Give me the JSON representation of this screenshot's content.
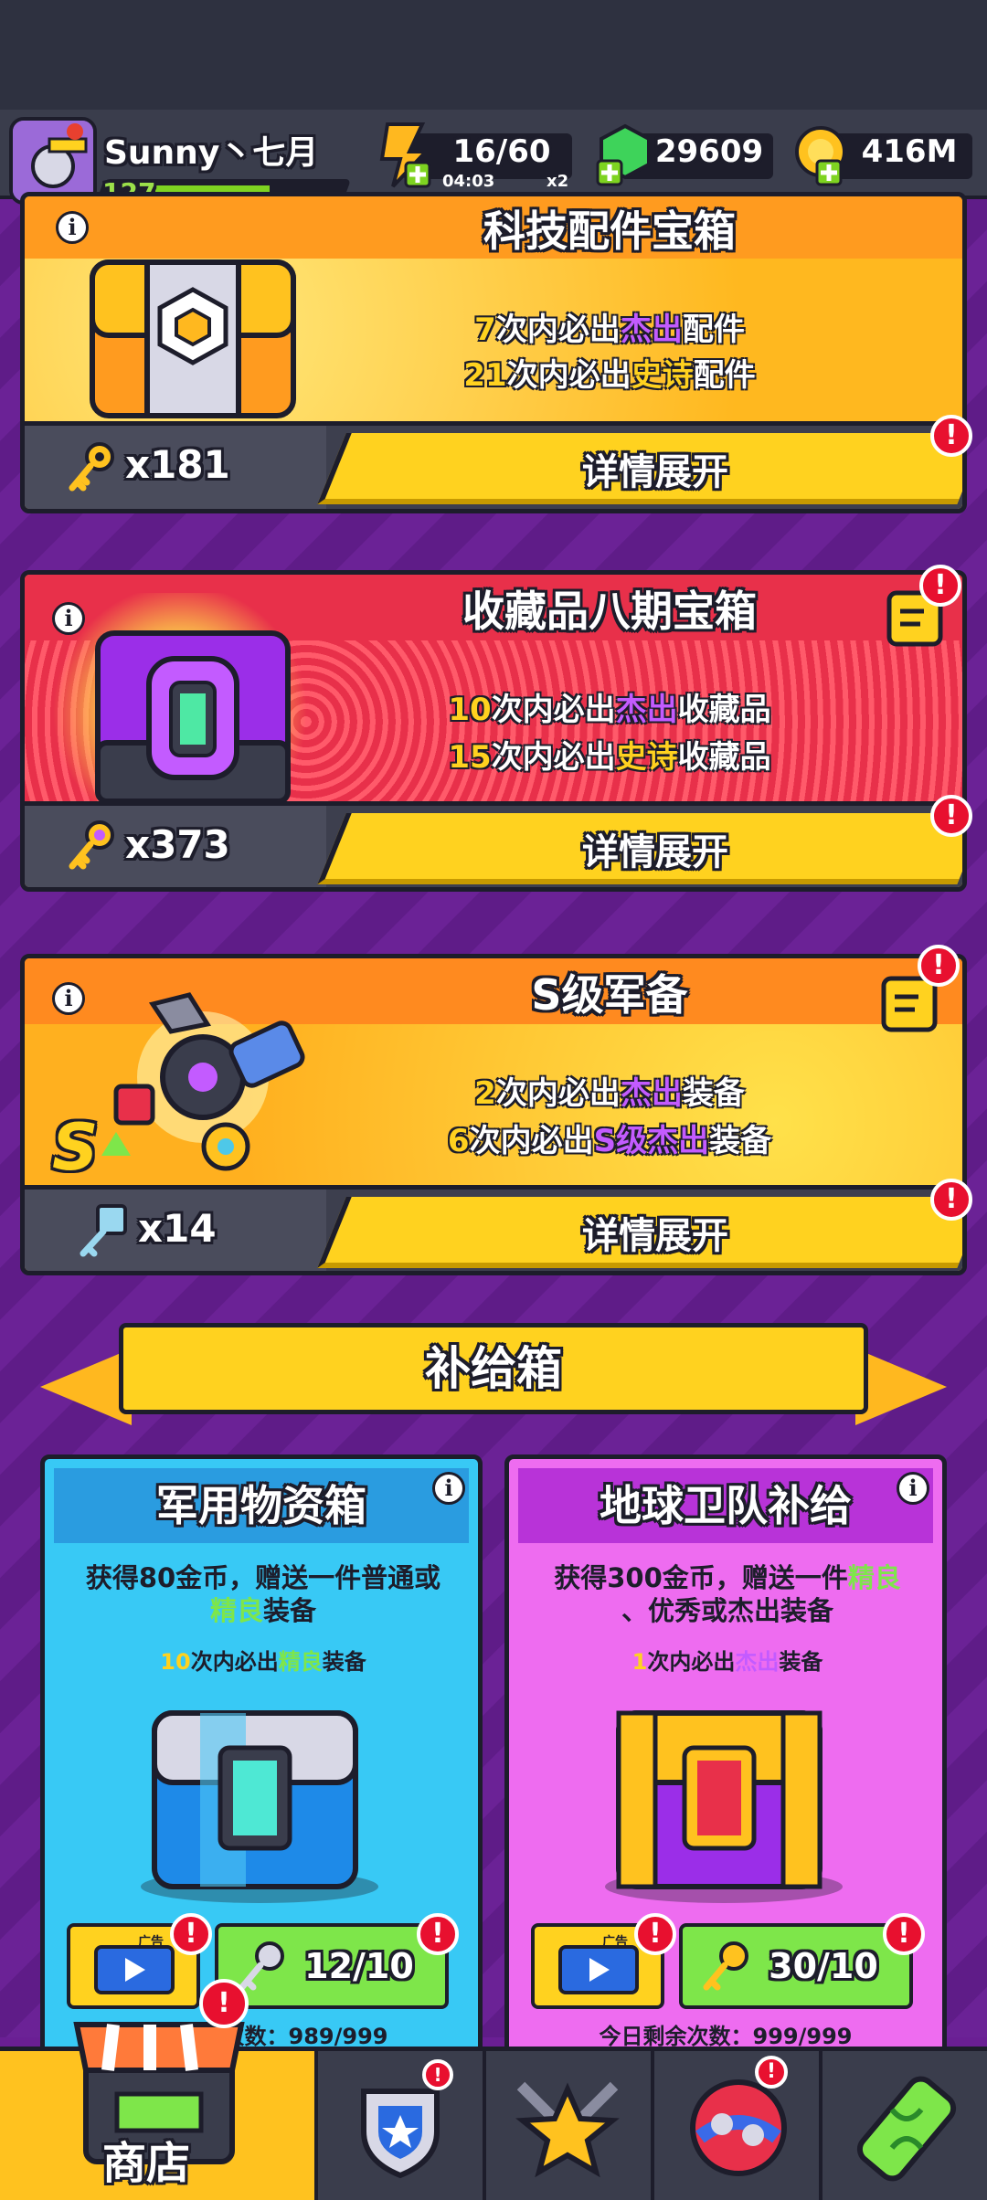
{
  "header": {
    "player_name": "Sunny丶七月",
    "level": "127",
    "level_progress": 0.55,
    "energy": {
      "value": "16/60",
      "timer": "04:03",
      "multiplier": "x2"
    },
    "gems": "29609",
    "coins": "416M"
  },
  "chests": [
    {
      "title": "科技配件宝箱",
      "line1": {
        "n": "7",
        "a": "次内必出",
        "r": "杰出",
        "b": "配件"
      },
      "line2": {
        "n": "21",
        "a": "次内必出",
        "r": "史诗",
        "b": "配件"
      },
      "keys": "x181",
      "detail": "详情展开",
      "badge": "!"
    },
    {
      "title": "收藏品八期宝箱",
      "line1": {
        "n": "10",
        "a": "次内必出",
        "r": "杰出",
        "b": "收藏品"
      },
      "line2": {
        "n": "15",
        "a": "次内必出",
        "r": "史诗",
        "b": "收藏品"
      },
      "keys": "x373",
      "detail": "详情展开",
      "badge": "!"
    },
    {
      "title": "S级军备",
      "line1": {
        "n": "2",
        "a": "次内必出",
        "r": "杰出",
        "b": "装备"
      },
      "line2": {
        "n": "6",
        "a": "次内必出",
        "r": "S级杰出",
        "b": "装备"
      },
      "keys": "x14",
      "detail": "详情展开",
      "badge": "!"
    }
  ],
  "supply": {
    "banner": "补给箱",
    "cards": [
      {
        "title": "军用物资箱",
        "desc_a": "获得80金币，赠送一件普通或",
        "desc_hl": "精良",
        "desc_b": "装备",
        "guar_n": "10",
        "guar_a": "次内必出",
        "guar_r": "精良",
        "guar_b": "装备",
        "ad_label": "广告",
        "keys": "12/10",
        "remain": "今日剩余次数：989/999",
        "colors": {
          "bg": "#38c9f5",
          "title": "#2a9ce0"
        }
      },
      {
        "title": "地球卫队补给",
        "desc_a": "获得300金币，赠送一件",
        "desc_hl": "精良",
        "desc_b": "、优秀或杰出装备",
        "guar_n": "1",
        "guar_a": "次内必出",
        "guar_r": "杰出",
        "guar_b": "装备",
        "ad_label": "广告",
        "keys": "30/10",
        "remain": "今日剩余次数：999/999",
        "colors": {
          "bg": "#ee6cf0",
          "title": "#b833d8"
        }
      }
    ]
  },
  "nav": {
    "shop_label": "商店",
    "tabs": [
      "shop",
      "badge",
      "battle",
      "planet",
      "lab"
    ]
  },
  "icons": [
    "energy-icon",
    "gem-icon",
    "coin-icon",
    "info-icon",
    "key-icon",
    "clipboard-icon",
    "video-ad-icon"
  ],
  "colors": {
    "accent": "#ffd21f",
    "alert": "#e8102f",
    "epic": "#c35bff",
    "fine": "#7ee64a",
    "panel_bg": "#6a1f94"
  }
}
